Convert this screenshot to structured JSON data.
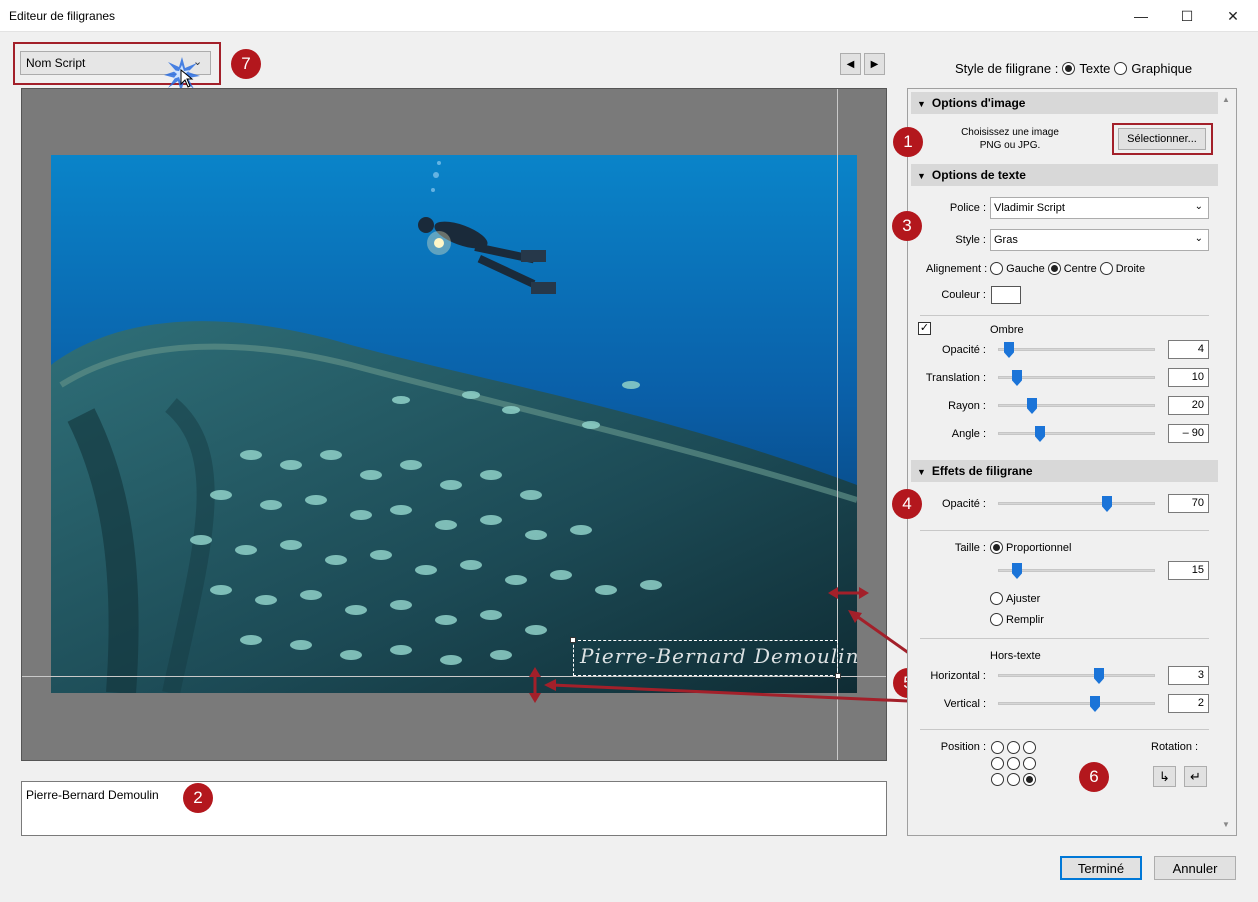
{
  "window": {
    "title": "Editeur de filigranes",
    "minimize": "—",
    "maximize": "☐",
    "close": "✕"
  },
  "preset": {
    "value": "Nom Script",
    "chevron": "⌄"
  },
  "markers": {
    "m1": "1",
    "m2": "2",
    "m3": "3",
    "m4": "4",
    "m5": "5",
    "m6": "6",
    "m7": "7"
  },
  "nav": {
    "prev": "◀",
    "next": "▶"
  },
  "watermark_text": "Pierre-Bernard Demoulin",
  "text_entry": "Pierre-Bernard Demoulin",
  "style": {
    "label": "Style de filigrane :",
    "texte": "Texte",
    "graphique": "Graphique",
    "selected": "Texte"
  },
  "image_options": {
    "header": "Options d'image",
    "hint_line1": "Choisissez une image",
    "hint_line2": "PNG ou JPG.",
    "select_button": "Sélectionner..."
  },
  "text_options": {
    "header": "Options de texte",
    "police_label": "Police :",
    "police_value": "Vladimir Script",
    "style_label": "Style :",
    "style_value": "Gras",
    "alignment_label": "Alignement :",
    "align_left": "Gauche",
    "align_center": "Centre",
    "align_right": "Droite",
    "align_selected": "Centre",
    "color_label": "Couleur :",
    "color_value": "#ffffff",
    "shadow_label": "Ombre",
    "shadow_enabled": true,
    "opacity_label": "Opacité :",
    "opacity_value": "4",
    "translation_label": "Translation :",
    "translation_value": "10",
    "radius_label": "Rayon :",
    "radius_value": "20",
    "angle_label": "Angle :",
    "angle_value": "– 90"
  },
  "effects": {
    "header": "Effets de filigrane",
    "opacity_label": "Opacité :",
    "opacity_value": "70",
    "size_label": "Taille :",
    "proportional": "Proportionnel",
    "size_value": "15",
    "adjust": "Ajuster",
    "fill": "Remplir",
    "size_mode": "Proportionnel",
    "offset_label": "Hors-texte",
    "horizontal_label": "Horizontal :",
    "horizontal_value": "3",
    "vertical_label": "Vertical :",
    "vertical_value": "2",
    "position_label": "Position :",
    "position_selected": "bottom-right",
    "rotation_label": "Rotation :",
    "rotate_left": "↳",
    "rotate_right": "↵"
  },
  "footer": {
    "done": "Terminé",
    "cancel": "Annuler"
  },
  "colors": {
    "accent": "#a3202a",
    "marker": "#b3171d",
    "slider": "#1b74d8",
    "sea": "#0b6fb0"
  }
}
